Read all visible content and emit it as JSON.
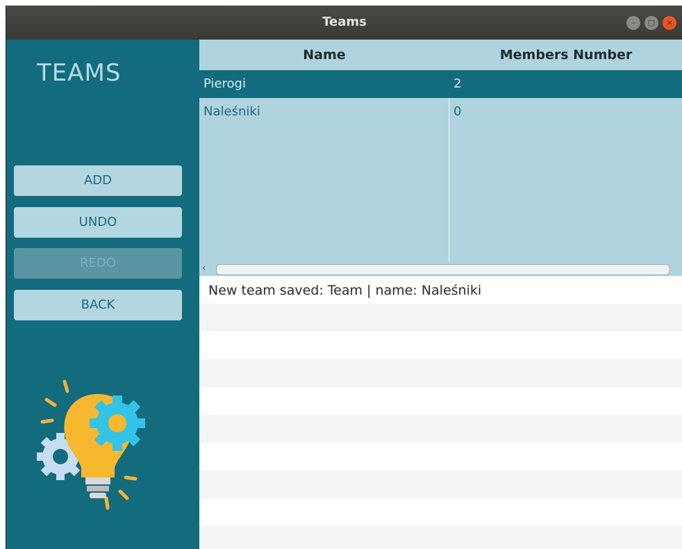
{
  "window": {
    "title": "Teams"
  },
  "sidebar": {
    "heading": "TEAMS",
    "buttons": [
      {
        "label": "ADD",
        "enabled": true
      },
      {
        "label": "UNDO",
        "enabled": true
      },
      {
        "label": "REDO",
        "enabled": false
      },
      {
        "label": "BACK",
        "enabled": true
      }
    ],
    "illustration": "lightbulb-gears-icon"
  },
  "table": {
    "columns": [
      "Name",
      "Members Number"
    ],
    "rows": [
      {
        "name": "Pierogi",
        "members": "2",
        "selected": true
      },
      {
        "name": "Naleśniki",
        "members": "0",
        "selected": false
      }
    ]
  },
  "log": {
    "messages": [
      "New team saved: Team | name: Naleśniki"
    ]
  },
  "colors": {
    "sidebar": "#136b7e",
    "table_bg": "#b0d4df",
    "selection": "#136b7e",
    "button": "#b4d6e0",
    "close_button": "#e95420"
  }
}
